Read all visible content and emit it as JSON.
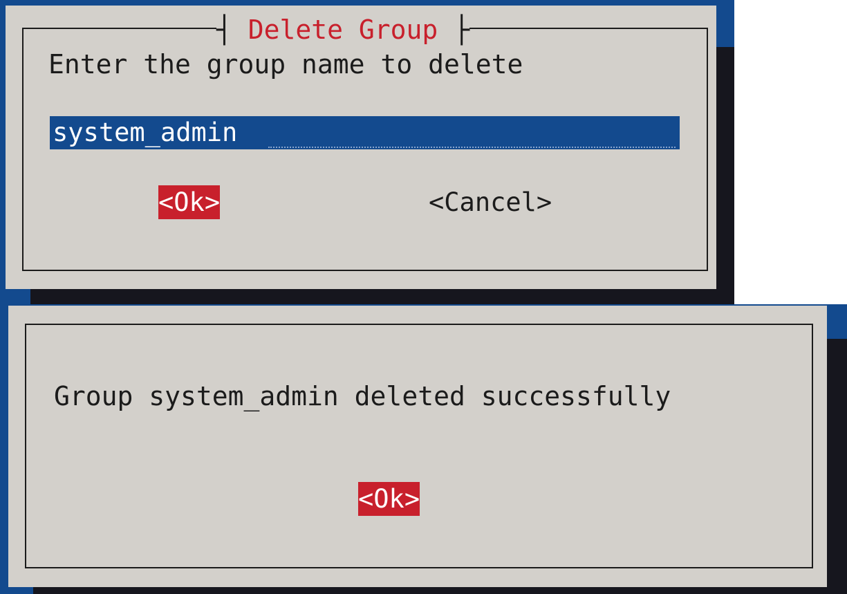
{
  "delete_dialog": {
    "title": "Delete Group",
    "prompt": "Enter the group name to delete",
    "input_value": "system_admin",
    "ok_label": "<Ok>",
    "cancel_label": "<Cancel>"
  },
  "result_dialog": {
    "message": "Group system_admin deleted successfully",
    "ok_label": "<Ok>"
  },
  "colors": {
    "dialog_bg": "#d3d0cb",
    "screen_blue": "#134a8e",
    "shadow": "#16161e",
    "accent_red": "#c8202c",
    "text": "#1b1b1b"
  }
}
